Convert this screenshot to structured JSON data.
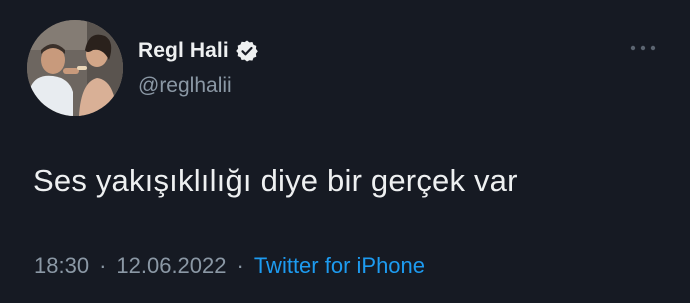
{
  "tweet": {
    "author": {
      "display_name": "Regl Hali",
      "handle": "@reglhalii",
      "verified": true
    },
    "text": "Ses yakışıklılığı diye bir gerçek var",
    "time": "18:30",
    "separator": "·",
    "date": "12.06.2022",
    "source": "Twitter for iPhone"
  },
  "icons": {
    "verified": "verified-badge-icon",
    "more": "more-dots-icon"
  },
  "colors": {
    "background": "#161a23",
    "text": "#eef0f1",
    "secondary": "#8b98a5",
    "link": "#1d9bf0"
  }
}
